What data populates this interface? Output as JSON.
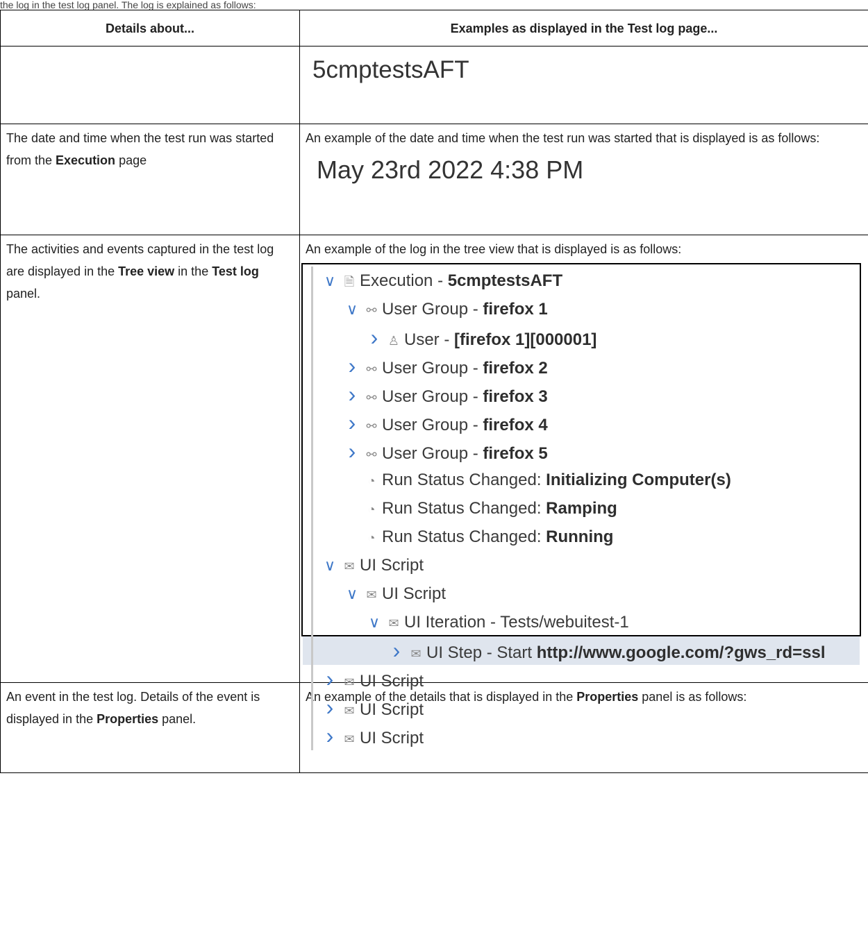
{
  "caption": "the log in the test log panel. The log is explained as follows:",
  "header": {
    "col1": "Details about...",
    "col2": "Examples as displayed in the Test log page..."
  },
  "rows": {
    "r1": {
      "example": "5cmptestsAFT"
    },
    "r2": {
      "details_a": "The date and time when the test run was started from the ",
      "details_b": "Execution",
      "details_c": " page",
      "example_intro": "An example of the date and time when the test run was started that is displayed is as follows:",
      "example_value": "May 23rd 2022 4:38 PM"
    },
    "r3": {
      "details_a": "The activities and events captured in the test log are displayed in the ",
      "details_b": "Tree view",
      "details_c": " in the ",
      "details_d": "Test log",
      "details_e": " panel.",
      "example_intro": "An example of the log in the tree view that is displayed is as follows:"
    },
    "r4": {
      "details_a": "An event in the test log. Details of the event is displayed in the ",
      "details_b": "Properties",
      "details_c": " panel.",
      "example_a": "An example of the details that is displayed in the ",
      "example_b": "Properties",
      "example_c": " panel is as follows:"
    }
  },
  "tree": [
    {
      "chev": "down",
      "icon": "document-icon",
      "text": "Execution - ",
      "bold": "5cmptestsAFT"
    },
    {
      "chev": "down",
      "icon": "user-group-icon",
      "text": "User Group - ",
      "bold": "firefox 1"
    },
    {
      "chev": "right",
      "icon": "user-icon",
      "text": "User - ",
      "bold": "[firefox 1][000001]"
    },
    {
      "chev": "right",
      "icon": "user-group-icon",
      "text": "User Group - ",
      "bold": "firefox 2"
    },
    {
      "chev": "right",
      "icon": "user-group-icon",
      "text": "User Group - ",
      "bold": "firefox 3"
    },
    {
      "chev": "right",
      "icon": "user-group-icon",
      "text": "User Group - ",
      "bold": "firefox 4"
    },
    {
      "chev": "right",
      "icon": "user-group-icon",
      "text": "User Group - ",
      "bold": "firefox 5"
    },
    {
      "chev": "none",
      "icon": "status-icon",
      "text": "Run Status Changed: ",
      "bold": "Initializing Computer(s)"
    },
    {
      "chev": "none",
      "icon": "status-icon",
      "text": "Run Status Changed: ",
      "bold": "Ramping"
    },
    {
      "chev": "none",
      "icon": "status-icon",
      "text": "Run Status Changed: ",
      "bold": "Running"
    },
    {
      "chev": "down",
      "icon": "ui-script-icon",
      "text": "UI Script",
      "bold": ""
    },
    {
      "chev": "down",
      "icon": "ui-script-icon",
      "text": "UI Script",
      "bold": ""
    },
    {
      "chev": "down",
      "icon": "ui-script-icon",
      "text": "UI Iteration - Tests/webuitest-1",
      "bold": ""
    },
    {
      "chev": "right",
      "icon": "ui-script-icon",
      "text": "UI Step - Start ",
      "bold": "http://www.google.com/?gws_rd=ssl",
      "selected": true
    },
    {
      "chev": "right",
      "icon": "ui-script-icon",
      "text": "UI Script",
      "bold": ""
    },
    {
      "chev": "right",
      "icon": "ui-script-icon",
      "text": "UI Script",
      "bold": ""
    },
    {
      "chev": "right",
      "icon": "ui-script-icon",
      "text": "UI Script",
      "bold": ""
    }
  ]
}
